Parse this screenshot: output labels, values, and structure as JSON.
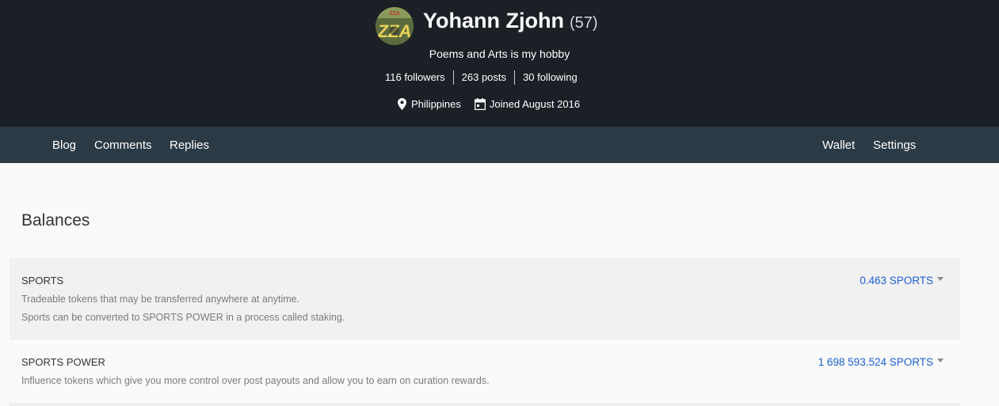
{
  "profile": {
    "name": "Yohann Zjohn",
    "reputation": "(57)",
    "about": "Poems and Arts is my hobby",
    "followers": "116 followers",
    "posts": "263 posts",
    "following": "30 following",
    "location": "Philippines",
    "joined": "Joined August 2016",
    "avatar_text": "ZZA",
    "avatar_icon": "avatar-image"
  },
  "nav": {
    "left": [
      "Blog",
      "Comments",
      "Replies"
    ],
    "right": [
      "Wallet",
      "Settings"
    ]
  },
  "balances": {
    "heading": "Balances",
    "items": [
      {
        "title": "SPORTS",
        "desc1": "Tradeable tokens that may be transferred anywhere at anytime.",
        "desc2": "Sports can be converted to SPORTS POWER in a process called staking.",
        "amount": "0.463 SPORTS"
      },
      {
        "title": "SPORTS POWER",
        "desc1": "Influence tokens which give you more control over post payouts and allow you to earn on curation rewards.",
        "amount": "1 698 593.524 SPORTS"
      }
    ]
  },
  "colors": {
    "header_bg": "#1b2026",
    "nav_bg": "#2c3a45",
    "link": "#1a5fd6"
  }
}
